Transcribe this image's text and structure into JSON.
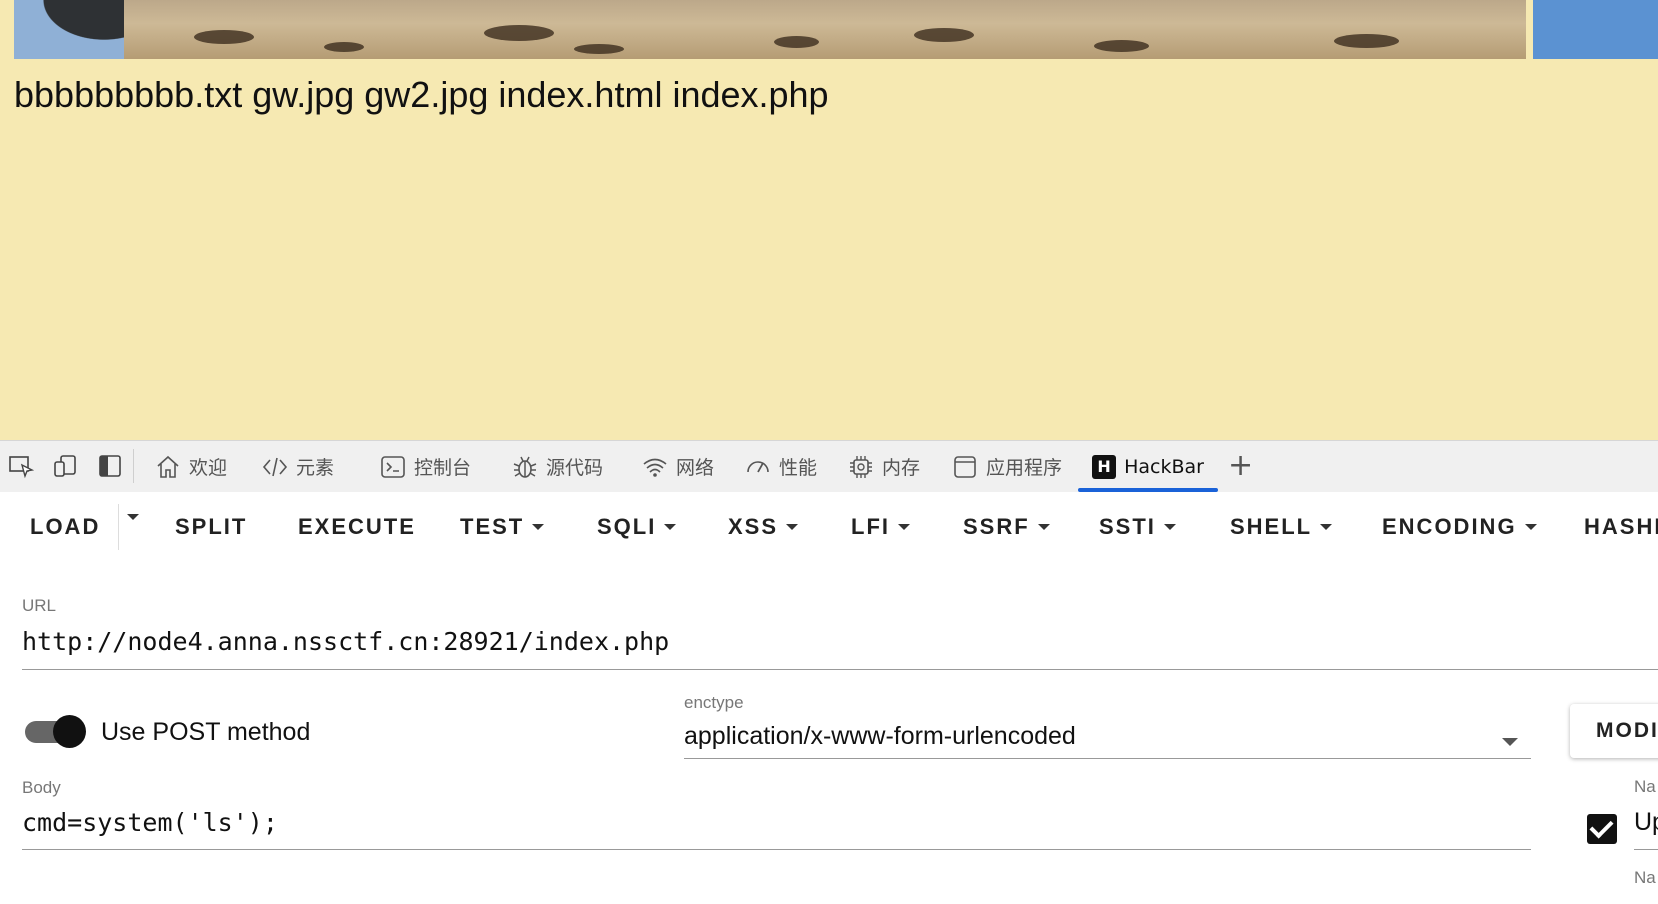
{
  "page": {
    "file_listing": "bbbbbbbbb.txt gw.jpg gw2.jpg index.html index.php"
  },
  "devtools": {
    "tabs": [
      {
        "label": "欢迎",
        "icon": "home-icon"
      },
      {
        "label": "元素",
        "icon": "code-icon"
      },
      {
        "label": "控制台",
        "icon": "console-icon"
      },
      {
        "label": "源代码",
        "icon": "bug-icon"
      },
      {
        "label": "网络",
        "icon": "wifi-icon"
      },
      {
        "label": "性能",
        "icon": "gauge-icon"
      },
      {
        "label": "内存",
        "icon": "chip-icon"
      },
      {
        "label": "应用程序",
        "icon": "app-window-icon"
      },
      {
        "label": "HackBar",
        "icon": "hackbar-logo-icon",
        "active": true
      }
    ],
    "hackbar_logo_letter": "H"
  },
  "hackbar": {
    "menu": {
      "load": "LOAD",
      "split": "SPLIT",
      "execute": "EXECUTE",
      "test": "TEST",
      "sqli": "SQLI",
      "xss": "XSS",
      "lfi": "LFI",
      "ssrf": "SSRF",
      "ssti": "SSTI",
      "shell": "SHELL",
      "encoding": "ENCODING",
      "hashing": "HASHI"
    },
    "url_label": "URL",
    "url_value": "http://node4.anna.nssctf.cn:28921/index.php",
    "post_toggle_label": "Use POST method",
    "post_enabled": true,
    "enctype_label": "enctype",
    "enctype_value": "application/x-www-form-urlencoded",
    "body_label": "Body",
    "body_value": "cmd=system('ls');",
    "modify_button": "MODI",
    "header_name_label": "Na",
    "header_value_partial": "Up",
    "header_name_label_2": "Na"
  },
  "colors": {
    "page_bg": "#f6e9b2",
    "active_tab_underline": "#1a62d8"
  }
}
